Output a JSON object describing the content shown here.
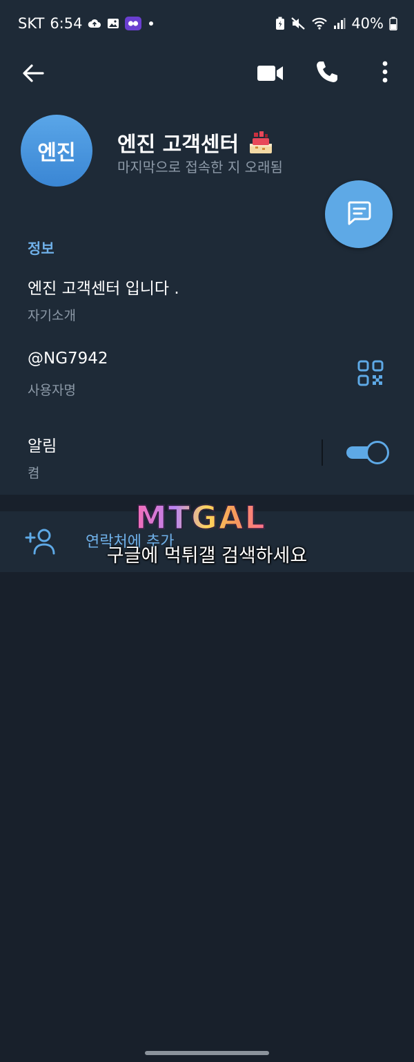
{
  "status_bar": {
    "carrier": "SKT",
    "time": "6:54",
    "battery_percent": "40%",
    "icons_left": [
      "cloud-upload-icon",
      "gallery-icon",
      "app-badge-icon",
      "dot-icon"
    ],
    "icons_right": [
      "battery-saver-icon",
      "mute-icon",
      "wifi-icon",
      "signal-icon",
      "battery-icon"
    ]
  },
  "app_bar": {
    "icons": [
      "back-arrow-icon",
      "video-call-icon",
      "phone-icon",
      "more-vert-icon"
    ]
  },
  "profile": {
    "avatar_text": "엔진",
    "avatar_color": "#4a97de",
    "name": "엔진 고객센터",
    "last_seen": "마지막으로 접속한 지 오래됨"
  },
  "info": {
    "section_title": "정보",
    "bio_value": "엔진 고객센터 입니다 .",
    "bio_label": "자기소개",
    "username_value": "@NG7942",
    "username_label": "사용자명",
    "notifications_value": "알림",
    "notifications_label": "켬",
    "notifications_on": true
  },
  "actions": {
    "add_contact": "연락처에 추가"
  },
  "overlay": {
    "logo_text": "MTGAL",
    "caption": "구글에 먹튀갤 검색하세요"
  },
  "colors": {
    "background": "#18202b",
    "card": "#1e2a37",
    "accent": "#5ea9e6",
    "accent_text": "#6fb0e8",
    "secondary_text": "#8d9aa8"
  }
}
